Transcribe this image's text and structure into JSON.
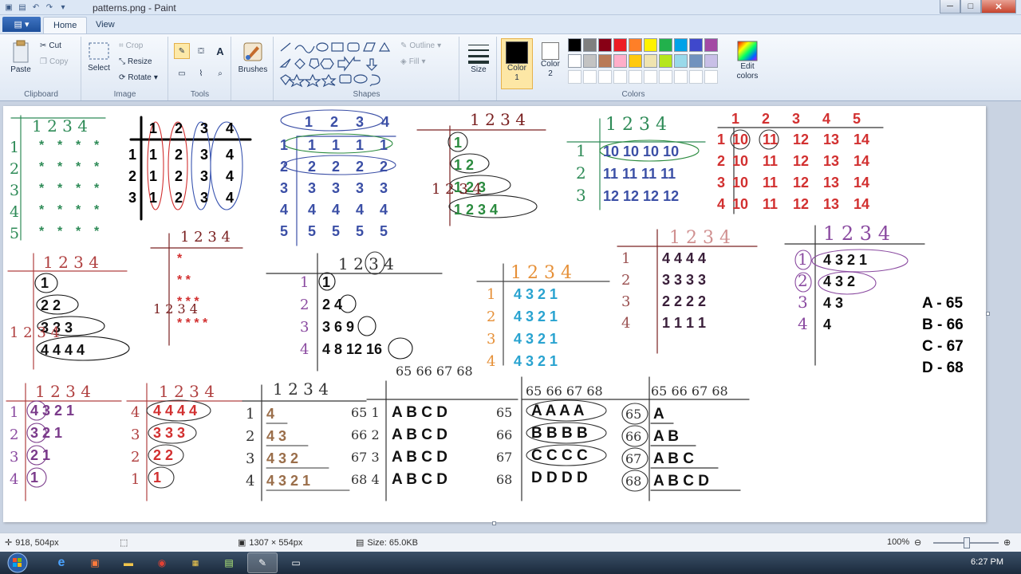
{
  "window": {
    "title": "patterns.png - Paint",
    "minimize_glyph": "─",
    "maximize_glyph": "□",
    "close_glyph": "✕"
  },
  "tabs": {
    "menu_glyph": "▤ ▾",
    "items": [
      "Home",
      "View"
    ]
  },
  "ribbon": {
    "clipboard": {
      "label": "Clipboard",
      "paste": "Paste",
      "cut": "Cut",
      "copy": "Copy"
    },
    "image": {
      "label": "Image",
      "select": "Select",
      "crop": "Crop",
      "resize": "Resize",
      "rotate": "Rotate"
    },
    "tools": {
      "label": "Tools"
    },
    "brushes": "Brushes",
    "shapes": {
      "label": "Shapes",
      "outline": "Outline",
      "fill": "Fill"
    },
    "size": "Size",
    "colors": {
      "label": "Colors",
      "color1": "Color 1",
      "color2": "Color 2",
      "edit": "Edit colors",
      "color1_value": "#000000",
      "color2_value": "#ffffff",
      "palette_row1": [
        "#000000",
        "#7f7f7f",
        "#880015",
        "#ed1c24",
        "#ff7f27",
        "#fff200",
        "#22b14c",
        "#00a2e8",
        "#3f48cc",
        "#a349a4"
      ],
      "palette_row2": [
        "#ffffff",
        "#c3c3c3",
        "#b97a57",
        "#ffaec9",
        "#ffc90e",
        "#efe4b0",
        "#b5e61d",
        "#99d9ea",
        "#7092be",
        "#c8bfe7"
      ]
    }
  },
  "canvas_notes": {
    "p1": {
      "header": "1 2 3 4",
      "rows": [
        "1",
        "2",
        "3",
        "4",
        "5"
      ],
      "cell": "*"
    },
    "p2": {
      "header": [
        "1",
        "2",
        "3",
        "4"
      ],
      "rows": [
        [
          "1",
          "1",
          "2",
          "3",
          "4"
        ],
        [
          "2",
          "1",
          "2",
          "3",
          "4"
        ],
        [
          "3",
          "1",
          "2",
          "3",
          "4"
        ]
      ]
    },
    "p3": {
      "header": [
        "1",
        "2",
        "3",
        "4"
      ],
      "rows": [
        [
          "1",
          "1",
          "1",
          "1",
          "1"
        ],
        [
          "2",
          "2",
          "2",
          "2",
          "2"
        ],
        [
          "3",
          "3",
          "3",
          "3",
          "3"
        ],
        [
          "4",
          "4",
          "4",
          "4",
          "4"
        ],
        [
          "5",
          "5",
          "5",
          "5",
          "5"
        ]
      ]
    },
    "p4": {
      "header": "1 2 3 4",
      "rows": [
        "1",
        "1 2",
        "1 2 3",
        "1 2 3 4"
      ]
    },
    "p5": {
      "header": "1 2 3 4",
      "rows": [
        [
          "1",
          "10 10 10 10"
        ],
        [
          "2",
          "11 11 11 11"
        ],
        [
          "3",
          "12 12 12 12"
        ]
      ]
    },
    "p6": {
      "header": [
        "1",
        "2",
        "3",
        "4",
        "5"
      ],
      "rows": [
        [
          "1",
          "10",
          "11",
          "12",
          "13",
          "14"
        ],
        [
          "2",
          "10",
          "11",
          "12",
          "13",
          "14"
        ],
        [
          "3",
          "10",
          "11",
          "12",
          "13",
          "14"
        ],
        [
          "4",
          "10",
          "11",
          "12",
          "13",
          "14"
        ]
      ]
    },
    "p7": {
      "header": "1 2 3 4",
      "rows": [
        "1",
        "2 2",
        "3 3 3",
        "4 4 4 4"
      ]
    },
    "p8": {
      "header": "1 2 3 4",
      "rows": [
        "*",
        "* *",
        "* * *",
        "* * * *"
      ]
    },
    "p9": {
      "header": "1 2 3 4",
      "rows": [
        [
          "1",
          "1"
        ],
        [
          "2",
          "2 4"
        ],
        [
          "3",
          "3 6 9"
        ],
        [
          "4",
          "4 8 12 16"
        ]
      ]
    },
    "p10": {
      "header": "1 2 3 4",
      "rows": [
        "4 3 2 1",
        "4 3 2 1",
        "4 3 2 1",
        "4 3 2 1"
      ]
    },
    "p11": {
      "header": "1 2 3 4",
      "rows": [
        "4 4 4 4",
        "3 3 3 3",
        "2 2 2 2",
        "1 1 1 1"
      ]
    },
    "p12": {
      "header": "1 2 3 4",
      "rows": [
        [
          "1",
          "4 3 2 1"
        ],
        [
          "2",
          "4 3 2"
        ],
        [
          "3",
          "4 3"
        ],
        [
          "4",
          "4"
        ]
      ]
    },
    "legend": [
      "A - 65",
      "B - 66",
      "C - 67",
      "D - 68"
    ],
    "p13": {
      "header": "1 2 3 4",
      "rows": [
        "4 3 2 1",
        "3 2 1",
        "2 1",
        "1"
      ]
    },
    "p14": {
      "header": "1 2 3 4",
      "rows": [
        "4 4 4 4",
        "3 3 3",
        "2 2",
        "1"
      ]
    },
    "p15": {
      "header": "1 2 3 4",
      "rows": [
        "4",
        "4 3",
        "4 3 2",
        "4 3 2 1"
      ]
    },
    "p16": {
      "header": "65 66 67 68",
      "rows": [
        [
          "65 1",
          "A B C D"
        ],
        [
          "66 2",
          "A B C D"
        ],
        [
          "67 3",
          "A B C D"
        ],
        [
          "68 4",
          "A B C D"
        ]
      ]
    },
    "p17": {
      "header": "65 66 67 68",
      "rows": [
        [
          "65",
          "A A A A"
        ],
        [
          "66",
          "B B B B"
        ],
        [
          "67",
          "C C C C"
        ],
        [
          "68",
          "D D D D"
        ]
      ]
    },
    "p18": {
      "header": "65 66 67 68",
      "rows": [
        [
          "65",
          "A"
        ],
        [
          "66",
          "A B"
        ],
        [
          "67",
          "A B C"
        ],
        [
          "68",
          "A B C D"
        ]
      ]
    }
  },
  "statusbar": {
    "cursor": "918, 504px",
    "dimensions": "1307 × 554px",
    "size": "Size: 65.0KB",
    "zoom": "100%"
  },
  "taskbar": {
    "clock": "6:27 PM"
  }
}
